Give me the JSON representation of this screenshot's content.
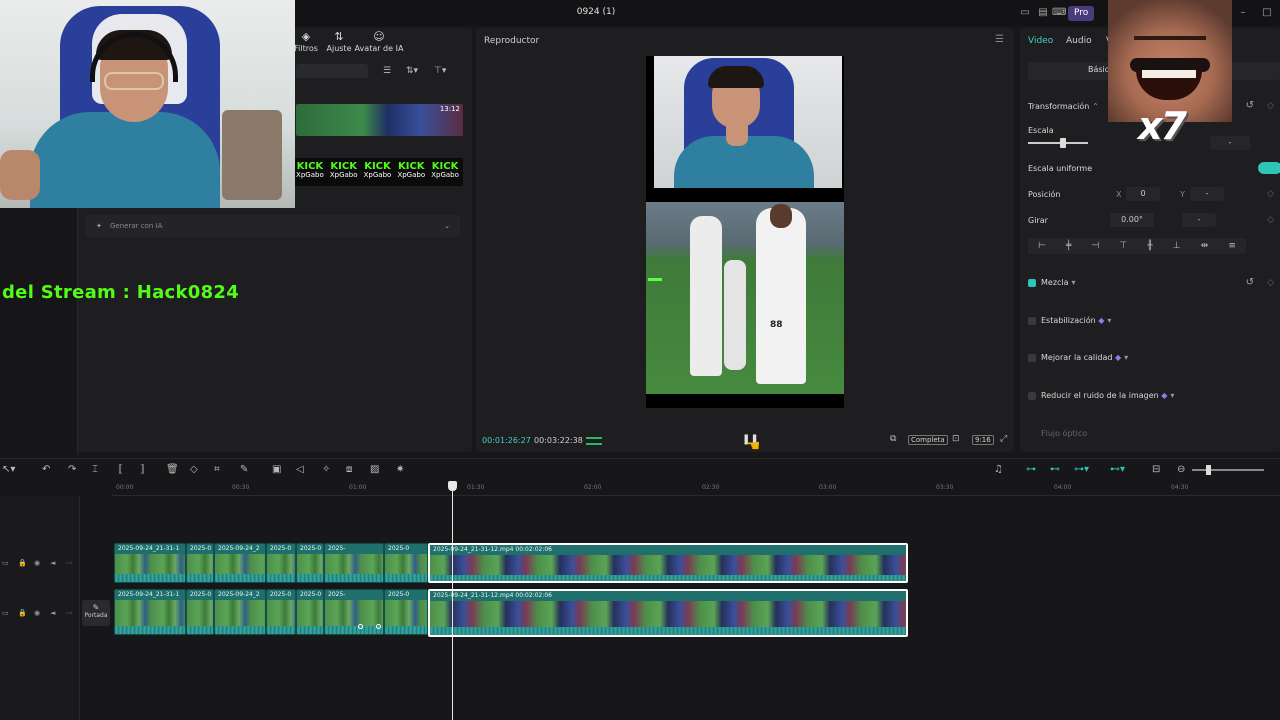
{
  "app": {
    "title": "0924 (1)",
    "pro_label": "Pro"
  },
  "media": {
    "tools": [
      {
        "label": "Filtros",
        "icon": "filter-icon"
      },
      {
        "label": "Ajuste",
        "icon": "adjust-icon"
      },
      {
        "label": "Avatar de IA",
        "icon": "avatar-icon"
      }
    ],
    "thumb_duration": "13:12",
    "kick_items": [
      {
        "top": "KICK",
        "bottom": "XpGabo"
      },
      {
        "top": "KICK",
        "bottom": "XpGabo"
      },
      {
        "top": "KICK",
        "bottom": "XpGabo"
      },
      {
        "top": "KICK",
        "bottom": "XpGabo"
      },
      {
        "top": "KICK",
        "bottom": "XpGabo"
      }
    ],
    "generate_label": "Generar con IA"
  },
  "overlay": {
    "stream_text": "del Stream : Hack0824",
    "meme_text": "x7"
  },
  "player": {
    "title": "Reproductor",
    "timecode_current": "00:01:26:27",
    "timecode_total": "00:03:22:38",
    "quality_label": "Completa",
    "ratio_label": "9:16",
    "jersey_number": "88"
  },
  "inspector": {
    "tabs": [
      "Video",
      "Audio",
      "V"
    ],
    "subtab": "Básico",
    "transform_label": "Transformación",
    "scale_label": "Escala",
    "scale_value": "-",
    "uniform_label": "Escala uniforme",
    "position_label": "Posición",
    "pos_x_label": "X",
    "pos_x_value": "0",
    "pos_y_label": "Y",
    "pos_y_value": "-",
    "rotate_label": "Girar",
    "rotate_value": "0.00°",
    "rotate_extra": "-",
    "blend_label": "Mezcla",
    "stabilize_label": "Estabilización",
    "improve_label": "Mejorar la calidad",
    "denoise_label": "Reducir el ruido de la imagen",
    "flow_label": "Flujo óptico"
  },
  "timeline": {
    "ruler": [
      "00:00",
      "00:30",
      "01:00",
      "01:30",
      "02:00",
      "02:30",
      "03:00",
      "03:30",
      "04:00",
      "04:30"
    ],
    "portada_label": "Portada",
    "track1_clips": [
      "2025-09-24_21-31-1",
      "2025-0",
      "2025-09-24_2",
      "2025-0",
      "2025-0",
      "2025-",
      "2025-0",
      "2025-09-24_21-31-12.mp4  00:02:02:06"
    ],
    "track2_clips": [
      "2025-09-24_21-31-1",
      "2025-0",
      "2025-09-24_2",
      "2025-0",
      "2025-0",
      "2025-",
      "2025-0",
      "2025-09-24_21-31-12.mp4  00:02:02:06"
    ]
  }
}
